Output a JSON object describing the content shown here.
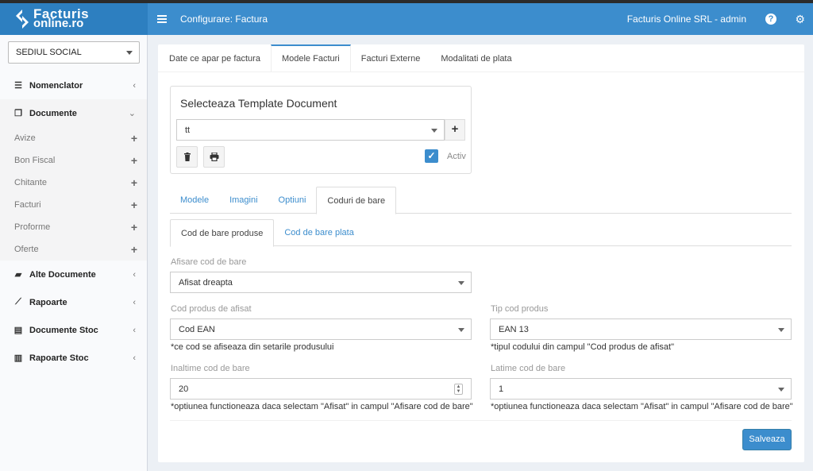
{
  "brand": {
    "line1": "Facturis",
    "line2": "online.ro"
  },
  "header": {
    "title": "Configurare: Factura",
    "user": "Facturis Online SRL - admin"
  },
  "sidebar": {
    "location_select": "SEDIUL SOCIAL",
    "items": [
      {
        "label": "Nomenclator",
        "icon": "list-icon"
      },
      {
        "label": "Documente",
        "icon": "copy-icon"
      },
      {
        "label": "Alte Documente",
        "icon": "folder-open-icon"
      },
      {
        "label": "Rapoarte",
        "icon": "line-chart-icon"
      },
      {
        "label": "Documente Stoc",
        "icon": "file-text-icon"
      },
      {
        "label": "Rapoarte Stoc",
        "icon": "bar-chart-icon"
      }
    ],
    "documente_sub": [
      "Avize",
      "Bon Fiscal",
      "Chitante",
      "Facturi",
      "Proforme",
      "Oferte"
    ]
  },
  "main_tabs": [
    "Date ce apar pe factura",
    "Modele Facturi",
    "Facturi Externe",
    "Modalitati de plata"
  ],
  "template": {
    "title": "Selecteaza Template Document",
    "selected": "tt",
    "active_label": "Activ",
    "active_checked": true
  },
  "section_tabs": [
    "Modele",
    "Imagini",
    "Optiuni",
    "Coduri de bare"
  ],
  "barcode_tabs": [
    "Cod de bare produse",
    "Cod de bare plata"
  ],
  "form": {
    "afisare_label": "Afisare cod de bare",
    "afisare_value": "Afisat dreapta",
    "cod_label": "Cod produs de afisat",
    "cod_value": "Cod EAN",
    "cod_note": "*ce cod se afiseaza din setarile produsului",
    "tip_label": "Tip cod produs",
    "tip_value": "EAN 13",
    "tip_note": "*tipul codului din campul \"Cod produs de afisat\"",
    "inaltime_label": "Inaltime cod de bare",
    "inaltime_value": "20",
    "inaltime_note": "*optiunea functioneaza daca selectam \"Afisat\" in campul \"Afisare cod de bare\"",
    "latime_label": "Latime cod de bare",
    "latime_value": "1",
    "latime_note": "*optiunea functioneaza daca selectam \"Afisat\" in campul \"Afisare cod de bare\""
  },
  "save_label": "Salveaza",
  "colors": {
    "accent": "#3c8dcd",
    "brand": "#2d7fc0"
  }
}
